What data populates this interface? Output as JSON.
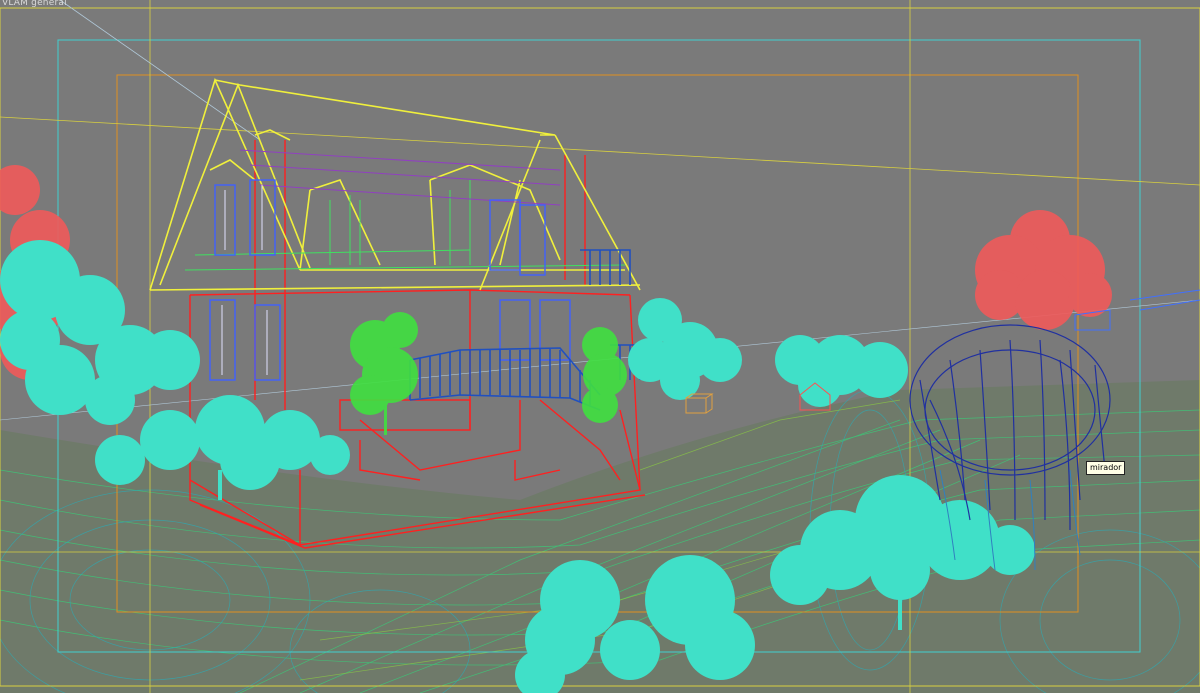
{
  "viewport": {
    "label": "VLAM general",
    "background": "#7a7a7a"
  },
  "tooltip": {
    "text": "mirador"
  },
  "wireframe_colors": {
    "roof": "#f0f03c",
    "walls": "#ff2020",
    "windows": "#4060ff",
    "deck": "#2050c0",
    "trees_cyan": "#40e0c8",
    "trees_red": "#f05050",
    "trees_green": "#40e040",
    "terrain": "#3cc878",
    "safe_frame_outer": "#40d0d0",
    "safe_frame_inner": "#e09020",
    "guide": "#e8e060"
  }
}
